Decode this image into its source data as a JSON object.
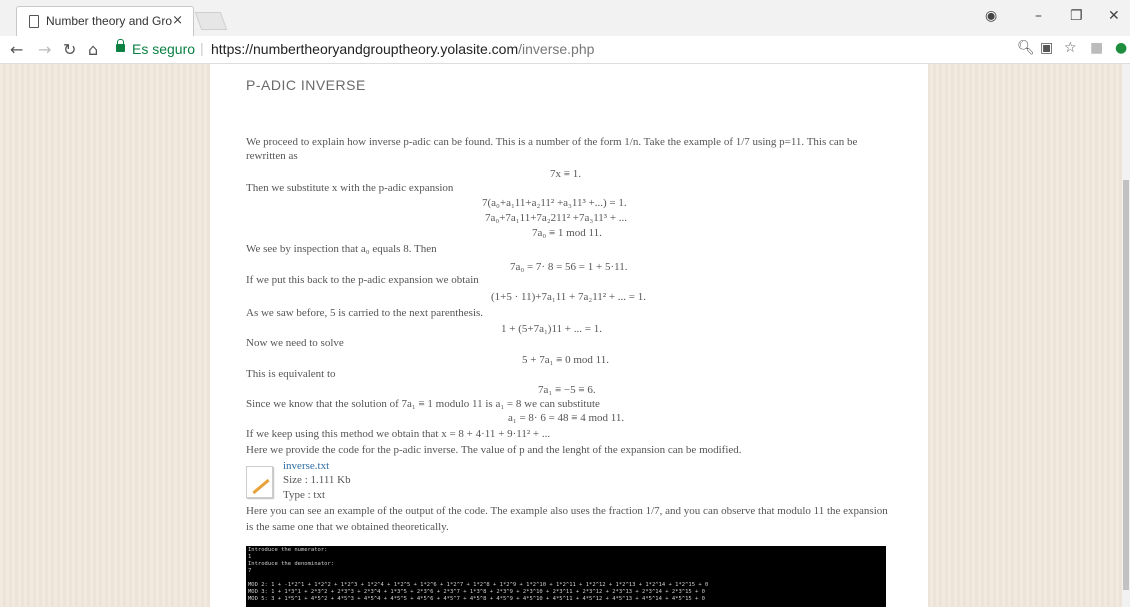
{
  "browser": {
    "tab_title": "Number theory and Grou",
    "tab_close": "×",
    "url_secure_label": "Es seguro",
    "url_host": "https://numbertheoryandgrouptheory.yolasite.com",
    "url_path": "/inverse.php",
    "icons": [
      "back-icon",
      "forward-icon",
      "reload-icon",
      "home-icon",
      "lock-icon",
      "zoom-icon",
      "translate-icon",
      "star-icon",
      "pdf-icon",
      "extension-icon",
      "profile-icon",
      "minimize-icon",
      "restore-icon",
      "close-window-icon"
    ]
  },
  "page": {
    "heading": "P-ADIC INVERSE",
    "lines": [
      "We proceed to explain how inverse p-adic can be found. This is a number of the form 1/n. Take the example of 1/7 using p=11. This can be",
      "rewritten as",
      "7x ≡ 1.",
      "Then we substitute x with the p-adic expansion",
      "7(a₀+a₁11+a₂11² +a₃11³ +...) = 1.",
      "7a₀+7a₁11+7a₂211² +7a₃11³ + ...",
      "7a₀ ≡ 1 mod 11.",
      "We see by inspection that a₀ equals 8. Then",
      "7a₀ = 7· 8 = 56 = 1 + 5·11.",
      "If we put this back to the p-adic expansion we obtain",
      "(1+5 · 11)+7a₁11 + 7a₂11² + ... = 1.",
      "As we saw before, 5 is carried to the next parenthesis.",
      "1 + (5+7a₁)11 + ... = 1.",
      "Now we need to solve",
      "5 + 7a₁ ≡ 0 mod 11.",
      "This is equivalent to",
      "7a₁ ≡ −5 ≡ 6.",
      "Since we know that the solution of 7a₁ ≡ 1 modulo 11 is a₁ = 8 we can substitute",
      "a₁ = 8· 6 = 48 ≡ 4 mod 11.",
      "If we keep using this method we obtain that x = 8 + 4·11 + 9·11² + ...",
      "Here we provide the code for the p-adic inverse. The value of p and the lenght of the expansion can be modified."
    ],
    "file": {
      "name": "inverse.txt",
      "size": "Size : 1.111 Kb",
      "type": "Type : txt"
    },
    "after_lines": [
      "Here you can see an example of the output of the code. The example also uses the fraction 1/7, and you can observe that modulo 11 the expansion",
      "is the same one that we obtained theoretically."
    ],
    "console_lines": [
      "Introduce the numerator:",
      "1",
      "Introduce the denominator:",
      "7",
      "",
      "MOD 2: 1 + -1*2^1 + 1*2^2 + 1*2^3 + 1*2^4 + 1*2^5 + 1*2^6 + 1*2^7 + 1*2^8 + 1*2^9 + 1*2^10 + 1*2^11 + 1*2^12 + 1*2^13 + 1*2^14 + 1*2^15 + 0",
      "MOD 3: 1 + 1*3^1 + 2*3^2 + 2*3^3 + 2*3^4 + 1*3^5 + 2*3^6 + 2*3^7 + 1*3^8 + 2*3^9 + 2*3^10 + 2*3^11 + 2*3^12 + 2*3^13 + 2*3^14 + 2*3^15 + 0",
      "MOD 5: 3 + 1*5^1 + 4*5^2 + 4*5^3 + 4*5^4 + 4*5^5 + 4*5^6 + 4*5^7 + 4*5^8 + 4*5^9 + 4*5^10 + 4*5^11 + 4*5^12 + 4*5^13 + 4*5^14 + 4*5^15 + 0"
    ]
  }
}
